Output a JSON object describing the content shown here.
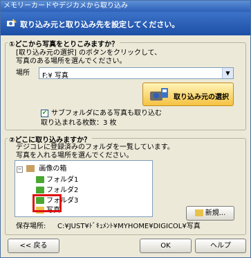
{
  "window": {
    "title": "メモリーカードやデジカメから取り込み"
  },
  "banner": {
    "message": "取り込み元と取り込み先を設定してください。",
    "icon": "camera-pencil-icon"
  },
  "source_section": {
    "title": "①どこから写真をとりこみますか？",
    "description_line1": "[取り込み元の選択] のボタンをクリックして、",
    "description_line2": "写真のある場所を選んでください。",
    "location_label": "場所",
    "location_value": "F:¥ 写真",
    "select_button_label": "取り込み元の選択",
    "subfolder_checkbox_label": "サブフォルダにある写真も取り込む",
    "subfolder_checked": true,
    "count_text": "取り込まれる枚数：3 枚"
  },
  "dest_section": {
    "title": "②どこに取り込みますか？",
    "description_line1": "デジコレに登録済みのフォルダを一覧しています。",
    "description_line2": "写真を入れる場所を選んでください。",
    "tree": {
      "root": "画像の箱",
      "children": [
        "フォルダ1",
        "フォルダ2",
        "フォルダ3",
        "写真"
      ],
      "selected": "写真"
    },
    "new_button_label": "新規...",
    "save_location_label": "保存場所:",
    "save_location_value": "C:¥JUST¥ﾄﾞｷｭﾒﾝﾄ¥MYHOME¥DIGICOL¥写真"
  },
  "footer": {
    "back_label": "<< 戻る",
    "ok_label": "OK",
    "help_label": "ヘルプ"
  },
  "colors": {
    "banner": "#1c4ea6",
    "highlight": "#e01010",
    "folder": "#4aa832"
  }
}
